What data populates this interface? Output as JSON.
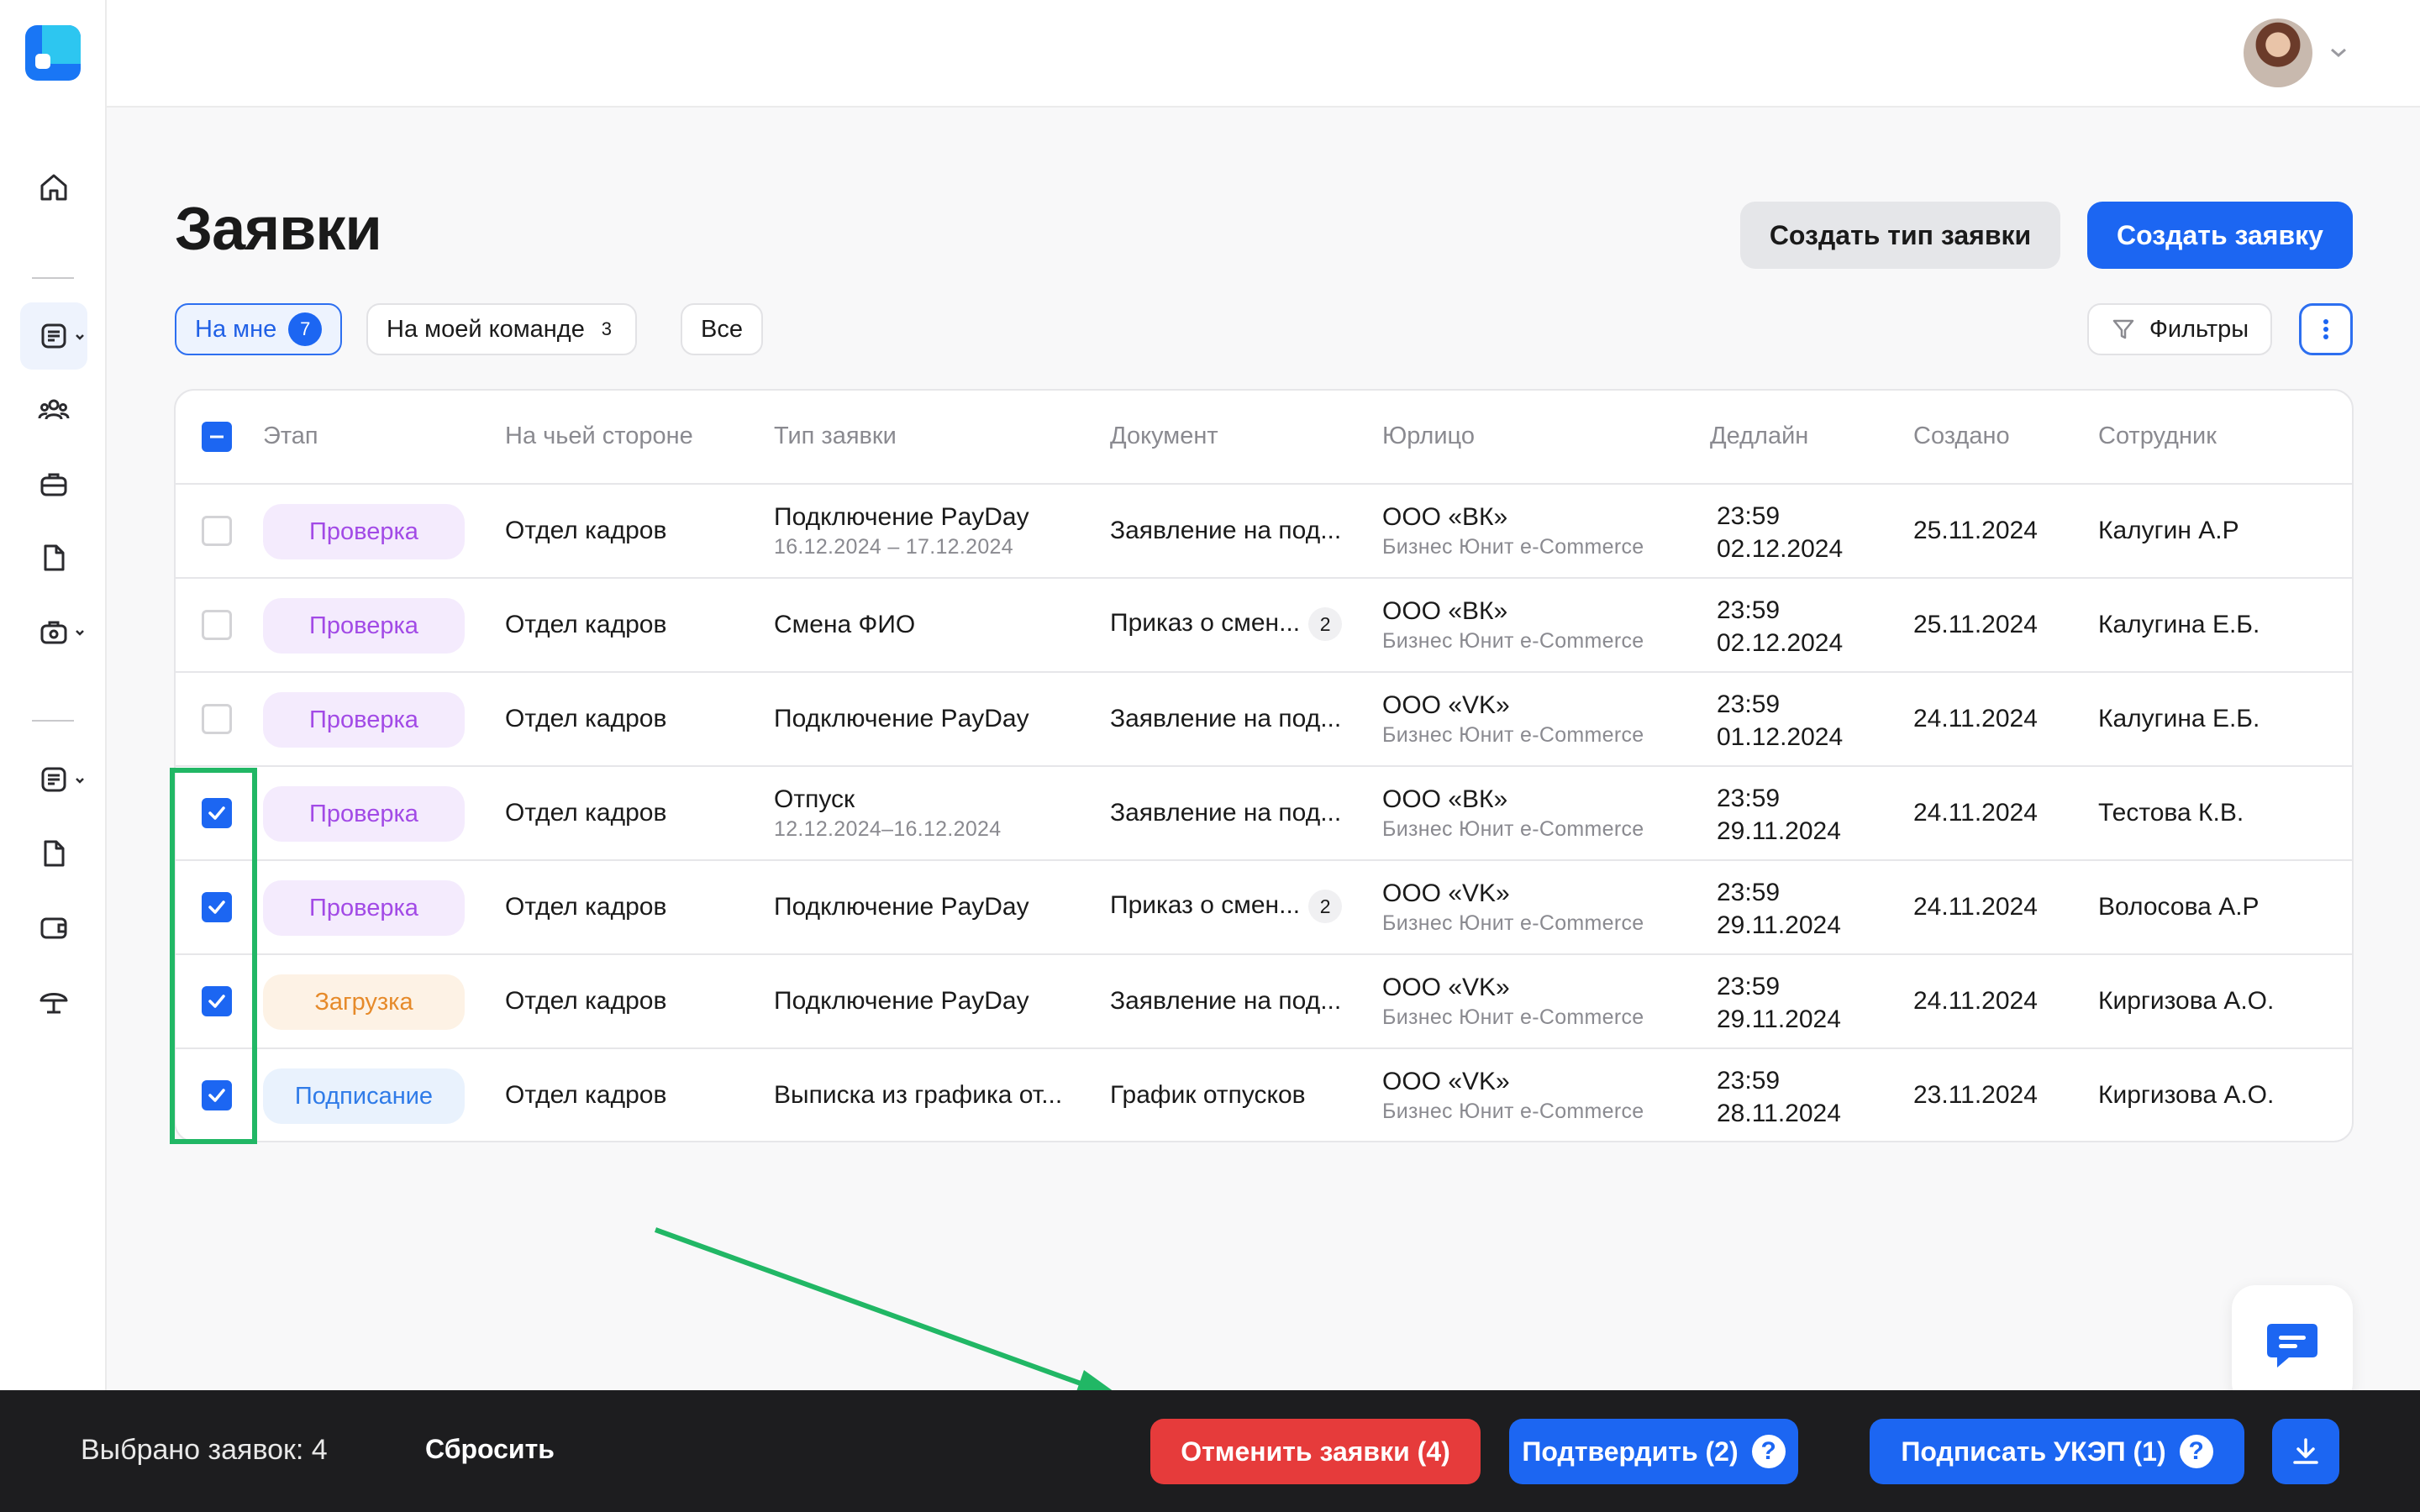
{
  "header": {
    "title": "Заявки",
    "create_type_label": "Создать тип заявки",
    "create_request_label": "Создать заявку"
  },
  "tabs": [
    {
      "label": "На мне",
      "count": "7"
    },
    {
      "label": "На моей команде",
      "count": "3"
    },
    {
      "label": "Все"
    }
  ],
  "filters_label": "Фильтры",
  "table": {
    "columns": [
      "Этап",
      "На чьей стороне",
      "Тип заявки",
      "Документ",
      "Юрлицо",
      "Дедлайн",
      "Создано",
      "Сотрудник"
    ],
    "rows": [
      {
        "checked": false,
        "stage": "Проверка",
        "side": "Отдел кадров",
        "type": "Подключение PayDay",
        "type_sub": "16.12.2024 – 17.12.2024",
        "doc": "Заявление на под...",
        "doc_count": "",
        "entity": "ООО «ВК»",
        "entity_sub": "Бизнес Юнит e-Commerce",
        "deadline_time": "23:59",
        "deadline_date": "02.12.2024",
        "created": "25.11.2024",
        "employee": "Калугин А.Р"
      },
      {
        "checked": false,
        "stage": "Проверка",
        "side": "Отдел кадров",
        "type": "Смена ФИО",
        "type_sub": "",
        "doc": "Приказ о смен...",
        "doc_count": "2",
        "entity": "ООО «ВК»",
        "entity_sub": "Бизнес Юнит e-Commerce",
        "deadline_time": "23:59",
        "deadline_date": "02.12.2024",
        "created": "25.11.2024",
        "employee": "Калугина Е.Б."
      },
      {
        "checked": false,
        "stage": "Проверка",
        "side": "Отдел кадров",
        "type": "Подключение PayDay",
        "type_sub": "",
        "doc": "Заявление на под...",
        "doc_count": "",
        "entity": "ООО «VK»",
        "entity_sub": "Бизнес Юнит e-Commerce",
        "deadline_time": "23:59",
        "deadline_date": "01.12.2024",
        "created": "24.11.2024",
        "employee": "Калугина Е.Б."
      },
      {
        "checked": true,
        "stage": "Проверка",
        "side": "Отдел кадров",
        "type": "Отпуск",
        "type_sub": "12.12.2024–16.12.2024",
        "doc": "Заявление на под...",
        "doc_count": "",
        "entity": "ООО «ВК»",
        "entity_sub": "Бизнес Юнит e-Commerce",
        "deadline_time": "23:59",
        "deadline_date": "29.11.2024",
        "created": "24.11.2024",
        "employee": "Тестова К.В."
      },
      {
        "checked": true,
        "stage": "Проверка",
        "side": "Отдел кадров",
        "type": "Подключение PayDay",
        "type_sub": "",
        "doc": "Приказ о смен...",
        "doc_count": "2",
        "entity": "ООО «VK»",
        "entity_sub": "Бизнес Юнит e-Commerce",
        "deadline_time": "23:59",
        "deadline_date": "29.11.2024",
        "created": "24.11.2024",
        "employee": "Волосова А.Р"
      },
      {
        "checked": true,
        "stage": "Загрузка",
        "side": "Отдел кадров",
        "type": "Подключение PayDay",
        "type_sub": "",
        "doc": "Заявление на под...",
        "doc_count": "",
        "entity": "ООО «VK»",
        "entity_sub": "Бизнес Юнит e-Commerce",
        "deadline_time": "23:59",
        "deadline_date": "29.11.2024",
        "created": "24.11.2024",
        "employee": "Киргизова А.О."
      },
      {
        "checked": true,
        "stage": "Подписание",
        "side": "Отдел кадров",
        "type": "Выписка из графика от...",
        "type_sub": "",
        "doc": "График отпусков",
        "doc_count": "",
        "entity": "ООО «VK»",
        "entity_sub": "Бизнес Юнит e-Commerce",
        "deadline_time": "23:59",
        "deadline_date": "28.11.2024",
        "created": "23.11.2024",
        "employee": "Киргизова А.О."
      }
    ]
  },
  "bottom_bar": {
    "selected_text": "Выбрано заявок: 4",
    "reset_label": "Сбросить",
    "cancel_label": "Отменить заявки (4)",
    "confirm_label": "Подтвердить (2)",
    "sign_label": "Подписать УКЭП (1)",
    "help_glyph": "?"
  },
  "colors": {
    "primary": "#1c66f2",
    "danger": "#e63b3b",
    "highlight": "#21b765",
    "bottom_bar_bg": "#1d1d1f"
  },
  "icons": [
    "logo",
    "home-icon",
    "requests-icon",
    "team-icon",
    "briefcase-icon",
    "document-icon",
    "settings-icon",
    "wallet-icon",
    "umbrella-icon",
    "filter-icon",
    "more-vertical-icon",
    "chat-icon",
    "download-icon",
    "help-icon",
    "chevron-down-icon"
  ]
}
